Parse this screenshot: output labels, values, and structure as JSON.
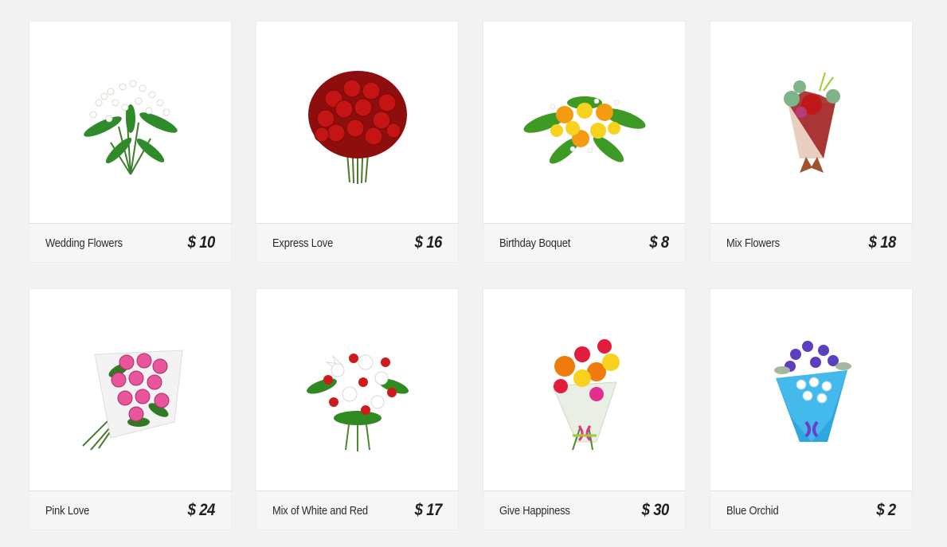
{
  "products": [
    {
      "name": "Wedding Flowers",
      "price": "$ 10",
      "image": "white-bouquet"
    },
    {
      "name": "Express Love",
      "price": "$ 16",
      "image": "red-rose-bouquet"
    },
    {
      "name": "Birthday Boquet",
      "price": "$ 8",
      "image": "orange-yellow-bouquet"
    },
    {
      "name": "Mix Flowers",
      "price": "$ 18",
      "image": "mixed-wrapped-bouquet"
    },
    {
      "name": "Pink Love",
      "price": "$ 24",
      "image": "pink-rose-bouquet"
    },
    {
      "name": "Mix of White and Red",
      "price": "$ 17",
      "image": "white-lily-red-rose-bouquet"
    },
    {
      "name": "Give Happiness",
      "price": "$ 30",
      "image": "gerbera-carnation-bouquet"
    },
    {
      "name": "Blue Orchid",
      "price": "$ 2",
      "image": "blue-orchid-bouquet"
    }
  ]
}
